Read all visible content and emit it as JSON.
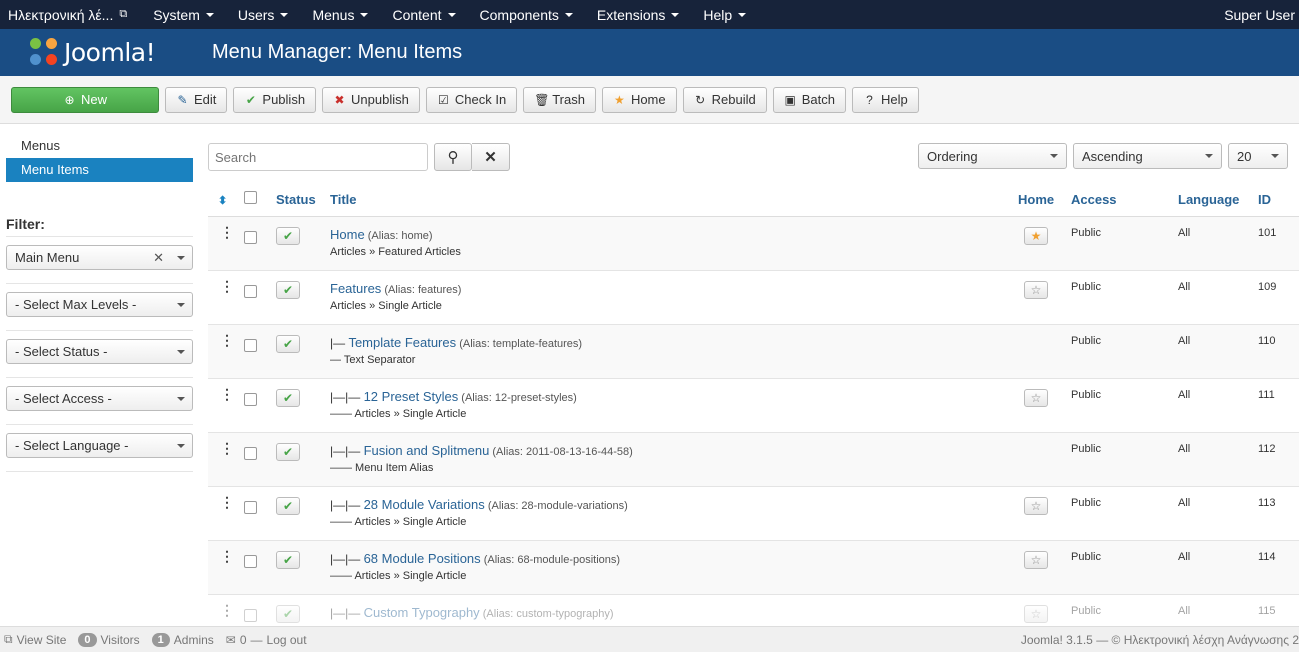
{
  "topbar": {
    "site_name": "Ηλεκτρονική λέ...",
    "menus": [
      "System",
      "Users",
      "Menus",
      "Content",
      "Components",
      "Extensions",
      "Help"
    ],
    "user": "Super User"
  },
  "header": {
    "logo_text": "Joomla!",
    "title": "Menu Manager: Menu Items"
  },
  "toolbar": {
    "new": "New",
    "edit": "Edit",
    "publish": "Publish",
    "unpublish": "Unpublish",
    "checkin": "Check In",
    "trash": "Trash",
    "home": "Home",
    "rebuild": "Rebuild",
    "batch": "Batch",
    "help": "Help"
  },
  "sidebar": {
    "links": [
      "Menus",
      "Menu Items"
    ],
    "filter_label": "Filter:",
    "filters": [
      "Main Menu",
      "- Select Max Levels -",
      "- Select Status -",
      "- Select Access -",
      "- Select Language -"
    ]
  },
  "search": {
    "placeholder": "Search"
  },
  "sorting": {
    "order_by": "Ordering",
    "direction": "Ascending",
    "limit": "20"
  },
  "table": {
    "headers": {
      "status": "Status",
      "title": "Title",
      "home": "Home",
      "access": "Access",
      "language": "Language",
      "id": "ID"
    },
    "rows": [
      {
        "prefix": "",
        "title": "Home",
        "alias": "(Alias: home)",
        "sub": "Articles » Featured Articles",
        "home": "default",
        "access": "Public",
        "language": "All",
        "id": "101"
      },
      {
        "prefix": "",
        "title": "Features",
        "alias": "(Alias: features)",
        "sub": "Articles » Single Article",
        "home": "star",
        "access": "Public",
        "language": "All",
        "id": "109"
      },
      {
        "prefix": "|— ",
        "title": "Template Features",
        "alias": "(Alias: template-features)",
        "sub": "— Text Separator",
        "home": "",
        "access": "Public",
        "language": "All",
        "id": "110"
      },
      {
        "prefix": "|—|— ",
        "title": "12 Preset Styles",
        "alias": "(Alias: 12-preset-styles)",
        "sub": "—— Articles » Single Article",
        "home": "star",
        "access": "Public",
        "language": "All",
        "id": "111"
      },
      {
        "prefix": "|—|— ",
        "title": "Fusion and Splitmenu",
        "alias": "(Alias: 2011-08-13-16-44-58)",
        "sub": "—— Menu Item Alias",
        "home": "",
        "access": "Public",
        "language": "All",
        "id": "112"
      },
      {
        "prefix": "|—|— ",
        "title": "28 Module Variations",
        "alias": "(Alias: 28-module-variations)",
        "sub": "—— Articles » Single Article",
        "home": "star",
        "access": "Public",
        "language": "All",
        "id": "113"
      },
      {
        "prefix": "|—|— ",
        "title": "68 Module Positions",
        "alias": "(Alias: 68-module-positions)",
        "sub": "—— Articles » Single Article",
        "home": "star",
        "access": "Public",
        "language": "All",
        "id": "114"
      },
      {
        "prefix": "|—|— ",
        "title": "Custom Typography",
        "alias": "(Alias: custom-typography)",
        "sub": "",
        "home": "star",
        "access": "Public",
        "language": "All",
        "id": "115"
      }
    ]
  },
  "statusbar": {
    "view_site": "View Site",
    "visitors_count": "0",
    "visitors": "Visitors",
    "admins_count": "1",
    "admins": "Admins",
    "messages_count": "0",
    "logout": "Log out",
    "right": "Joomla! 3.1.5 — © Ηλεκτρονική λέσχη Ανάγνωσης 2"
  }
}
